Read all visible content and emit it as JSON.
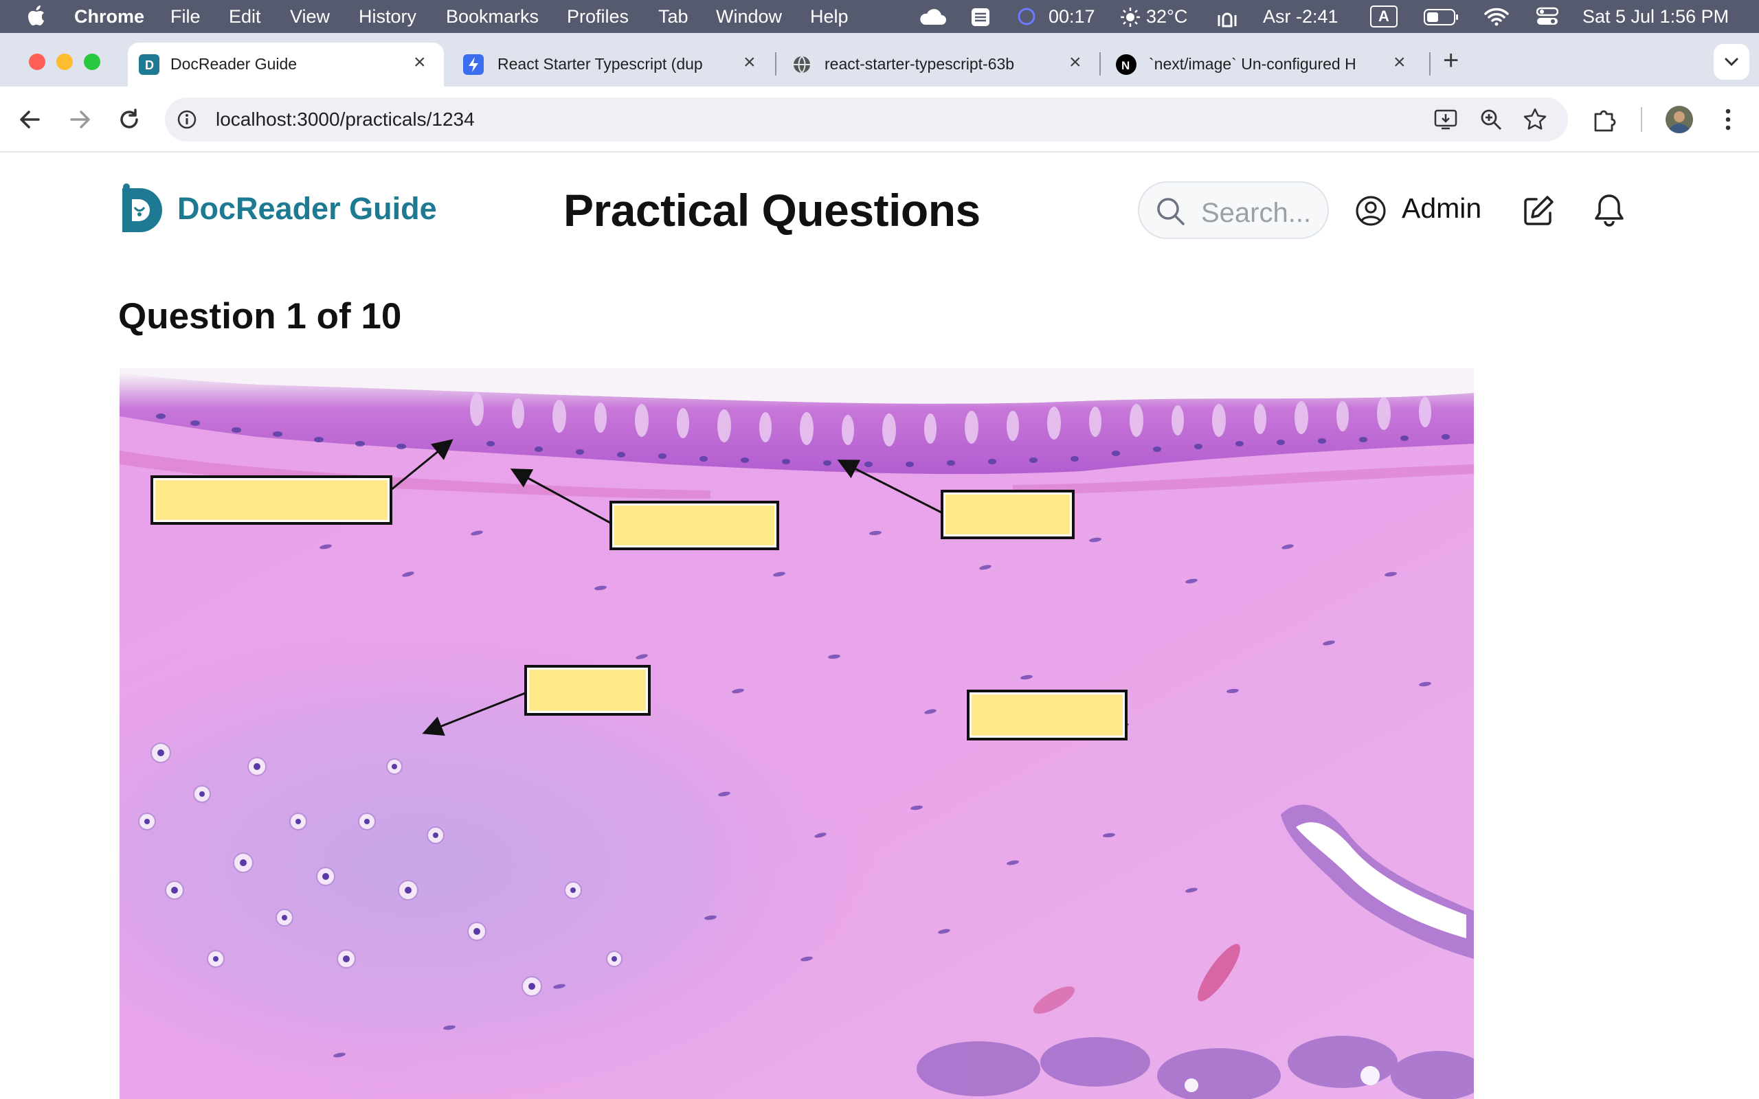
{
  "menubar": {
    "app": "Chrome",
    "items": [
      "File",
      "Edit",
      "View",
      "History",
      "Bookmarks",
      "Profiles",
      "Tab",
      "Window",
      "Help"
    ],
    "timer": "00:17",
    "weather": "32°C",
    "prayer": "Asr -2:41",
    "input_source": "A",
    "datetime": "Sat 5 Jul  1:56 PM"
  },
  "tabs": [
    {
      "title": "DocReader Guide",
      "active": true,
      "favicon": "docreader-icon"
    },
    {
      "title": "React Starter Typescript (dup",
      "active": false,
      "favicon": "bolt-icon"
    },
    {
      "title": "react-starter-typescript-63b",
      "active": false,
      "favicon": "globe-icon"
    },
    {
      "title": "`next/image` Un-configured H",
      "active": false,
      "favicon": "nextjs-icon"
    }
  ],
  "toolbar": {
    "url": "localhost:3000/practicals/1234"
  },
  "header": {
    "brand": "DocReader Guide",
    "title": "Practical Questions",
    "search_placeholder": "Search...",
    "user": "Admin"
  },
  "question": {
    "heading": "Question 1 of 10"
  },
  "colors": {
    "brand": "#1e7a92",
    "label_fill": "#fde98a",
    "tissue_base": "#e79be8",
    "nuclei": "#4a3a9e"
  }
}
